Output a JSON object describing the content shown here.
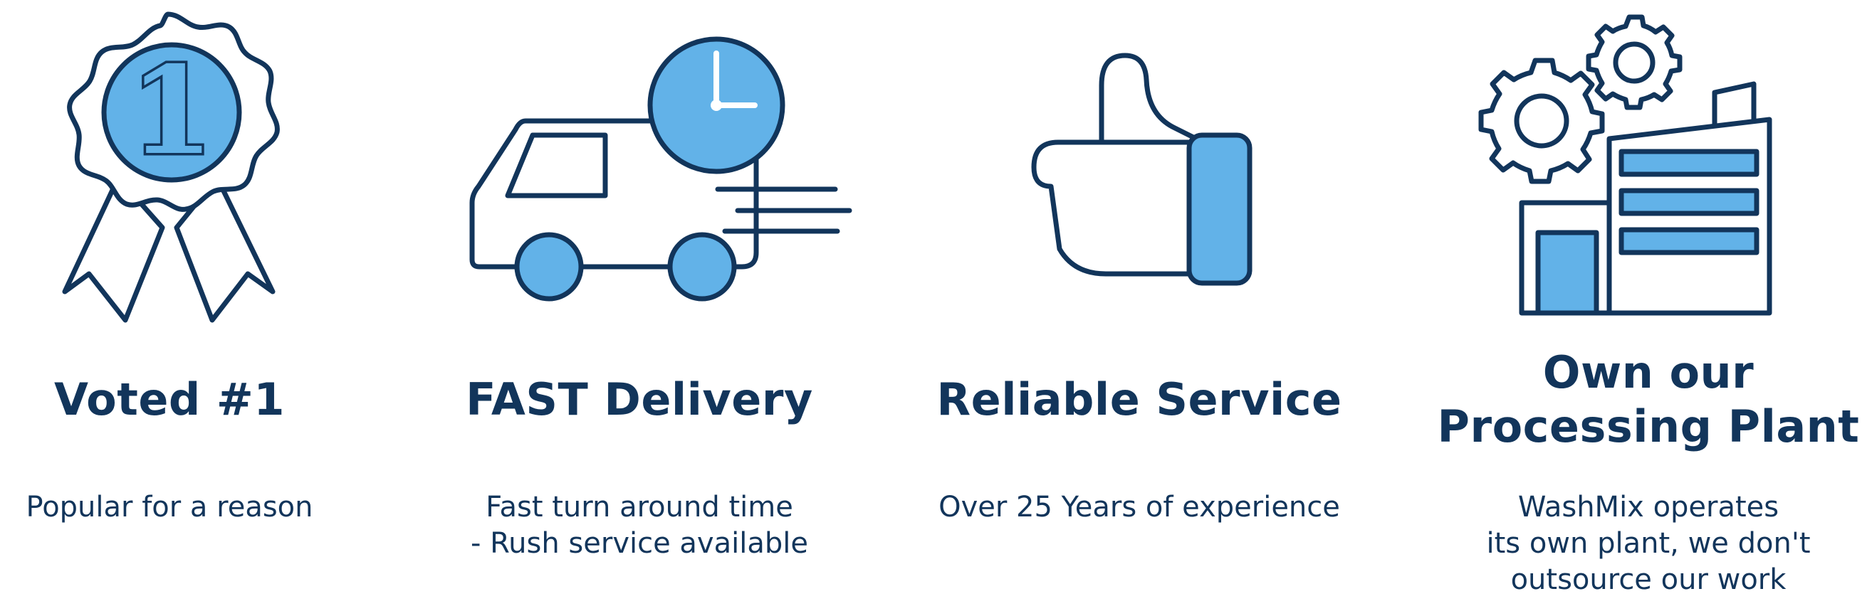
{
  "colors": {
    "navy": "#12355b",
    "accent": "#62b2e8",
    "background": "#ffffff"
  },
  "features": [
    {
      "icon": "award-ribbon-icon",
      "badge_number": "1",
      "title_lines": [
        "Voted #1"
      ],
      "desc_lines": [
        "Popular for a reason"
      ]
    },
    {
      "icon": "delivery-van-clock-icon",
      "title_lines": [
        "FAST Delivery"
      ],
      "desc_lines": [
        "Fast turn around time",
        "- Rush service available"
      ]
    },
    {
      "icon": "thumbs-up-icon",
      "title_lines": [
        "Reliable Service"
      ],
      "desc_lines": [
        "Over 25 Years of experience"
      ]
    },
    {
      "icon": "factory-gears-icon",
      "title_lines": [
        "Own our",
        "Processing Plant"
      ],
      "desc_lines": [
        "WashMix operates",
        "its own plant, we don't",
        "outsource our work"
      ]
    }
  ]
}
